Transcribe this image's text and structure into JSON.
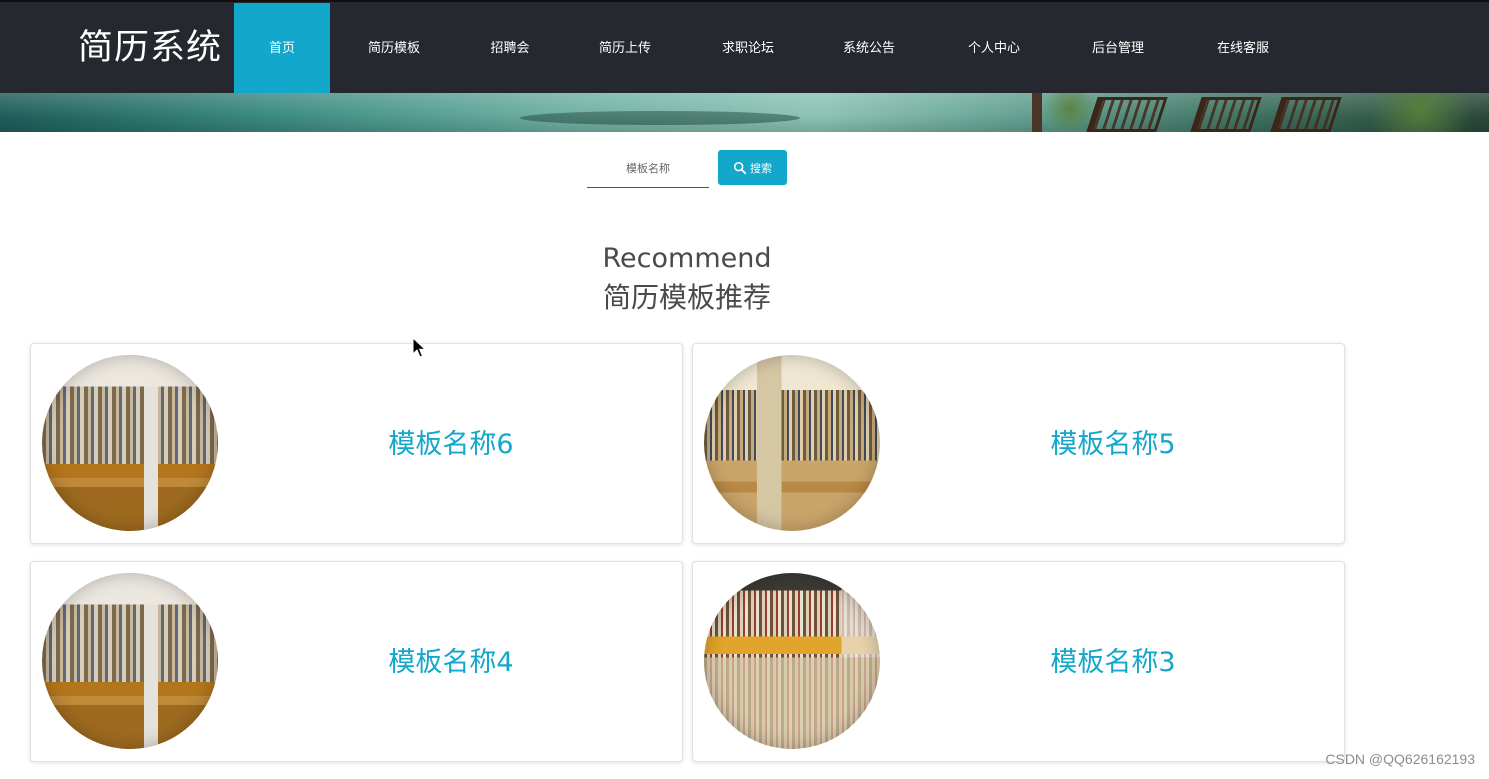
{
  "header": {
    "logo": "简历系统",
    "nav": [
      {
        "label": "首页",
        "active": true
      },
      {
        "label": "简历模板",
        "active": false
      },
      {
        "label": "招聘会",
        "active": false
      },
      {
        "label": "简历上传",
        "active": false
      },
      {
        "label": "求职论坛",
        "active": false
      },
      {
        "label": "系统公告",
        "active": false
      },
      {
        "label": "个人中心",
        "active": false
      },
      {
        "label": "后台管理",
        "active": false
      },
      {
        "label": "在线客服",
        "active": false
      }
    ]
  },
  "search": {
    "placeholder": "模板名称",
    "button_label": "搜索"
  },
  "section": {
    "title_en": "Recommend",
    "title_zh": "简历模板推荐"
  },
  "cards": [
    {
      "name": "模板名称6",
      "image": "library-reading-room"
    },
    {
      "name": "模板名称5",
      "image": "library-long-aisle"
    },
    {
      "name": "模板名称4",
      "image": "library-reading-room"
    },
    {
      "name": "模板名称3",
      "image": "library-bookstore-hall"
    }
  ],
  "colors": {
    "header_bg": "#25282e",
    "accent": "#13a7cc",
    "title_text": "#4a4a4a"
  },
  "watermark": "CSDN @QQ626162193"
}
